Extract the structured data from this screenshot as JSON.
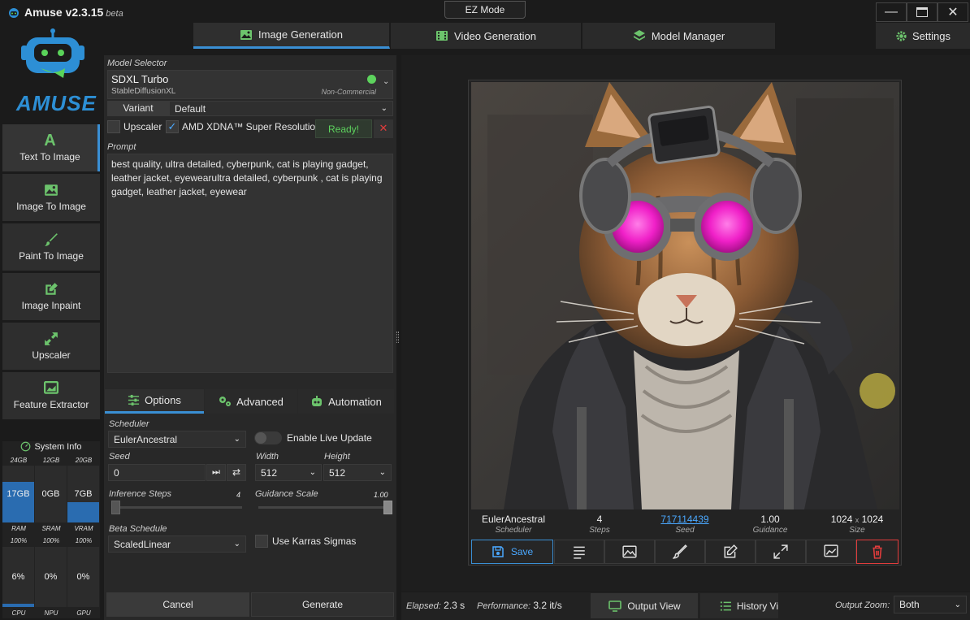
{
  "app": {
    "title": "Amuse v2.3.15",
    "beta": "beta",
    "logo_text": "AMUSE",
    "ez_mode": "EZ Mode"
  },
  "tabs": [
    {
      "label": "Image Generation"
    },
    {
      "label": "Video Generation"
    },
    {
      "label": "Model Manager"
    }
  ],
  "settings_label": "Settings",
  "sidebar": [
    {
      "label": "Text To Image"
    },
    {
      "label": "Image To Image"
    },
    {
      "label": "Paint To Image"
    },
    {
      "label": "Image Inpaint"
    },
    {
      "label": "Upscaler"
    },
    {
      "label": "Feature Extractor"
    }
  ],
  "system_info": {
    "title": "System Info",
    "mem_totals": [
      "24GB",
      "12GB",
      "20GB"
    ],
    "mem_values": [
      "17GB",
      "0GB",
      "7GB"
    ],
    "mem_labels": [
      "RAM",
      "SRAM",
      "VRAM"
    ],
    "mem_fill": [
      0.71,
      0.0,
      0.35
    ],
    "proc_totals": [
      "100%",
      "100%",
      "100%"
    ],
    "proc_values": [
      "6%",
      "0%",
      "0%"
    ],
    "proc_labels": [
      "CPU",
      "NPU",
      "GPU"
    ],
    "proc_fill": [
      0.06,
      0.0,
      0.0
    ]
  },
  "model": {
    "selector_label": "Model Selector",
    "name": "SDXL Turbo",
    "type": "StableDiffusionXL",
    "license": "Non-Commercial",
    "variant_label": "Variant",
    "variant_value": "Default",
    "upscaler_label": "Upscaler",
    "amd_label": "AMD XDNA™ Super Resolution",
    "ready_label": "Ready!"
  },
  "prompt": {
    "label": "Prompt",
    "text": "best quality, ultra detailed, cyberpunk, cat is playing gadget, leather jacket, eyewearultra detailed, cyberpunk , cat is playing gadget, leather jacket, eyewear"
  },
  "subtabs": [
    {
      "label": "Options"
    },
    {
      "label": "Advanced"
    },
    {
      "label": "Automation"
    }
  ],
  "options": {
    "scheduler_label": "Scheduler",
    "scheduler_value": "EulerAncestral",
    "live_update_label": "Enable Live Update",
    "seed_label": "Seed",
    "seed_value": "0",
    "width_label": "Width",
    "width_value": "512",
    "height_label": "Height",
    "height_value": "512",
    "steps_label": "Inference Steps",
    "steps_value": "4",
    "guidance_label": "Guidance Scale",
    "guidance_value": "1.00",
    "beta_label": "Beta Schedule",
    "beta_value": "ScaledLinear",
    "karras_label": "Use Karras Sigmas"
  },
  "actions": {
    "cancel": "Cancel",
    "generate": "Generate"
  },
  "result": {
    "scheduler": "EulerAncestral",
    "scheduler_lbl": "Scheduler",
    "steps": "4",
    "steps_lbl": "Steps",
    "seed": "717114439",
    "seed_lbl": "Seed",
    "guidance": "1.00",
    "guidance_lbl": "Guidance",
    "size_w": "1024",
    "size_x": "x",
    "size_h": "1024",
    "size_lbl": "Size",
    "save_label": "Save"
  },
  "status": {
    "elapsed_label": "Elapsed:",
    "elapsed_value": "2.3 s",
    "perf_label": "Performance:",
    "perf_value": "3.2 it/s",
    "output_view": "Output View",
    "history_view": "History Vi",
    "zoom_label": "Output Zoom:",
    "zoom_value": "Both"
  },
  "colors": {
    "accent": "#3a8fd4",
    "ready": "#5dd35d",
    "danger": "#e03c3c",
    "meter": "#2a6cb0"
  }
}
